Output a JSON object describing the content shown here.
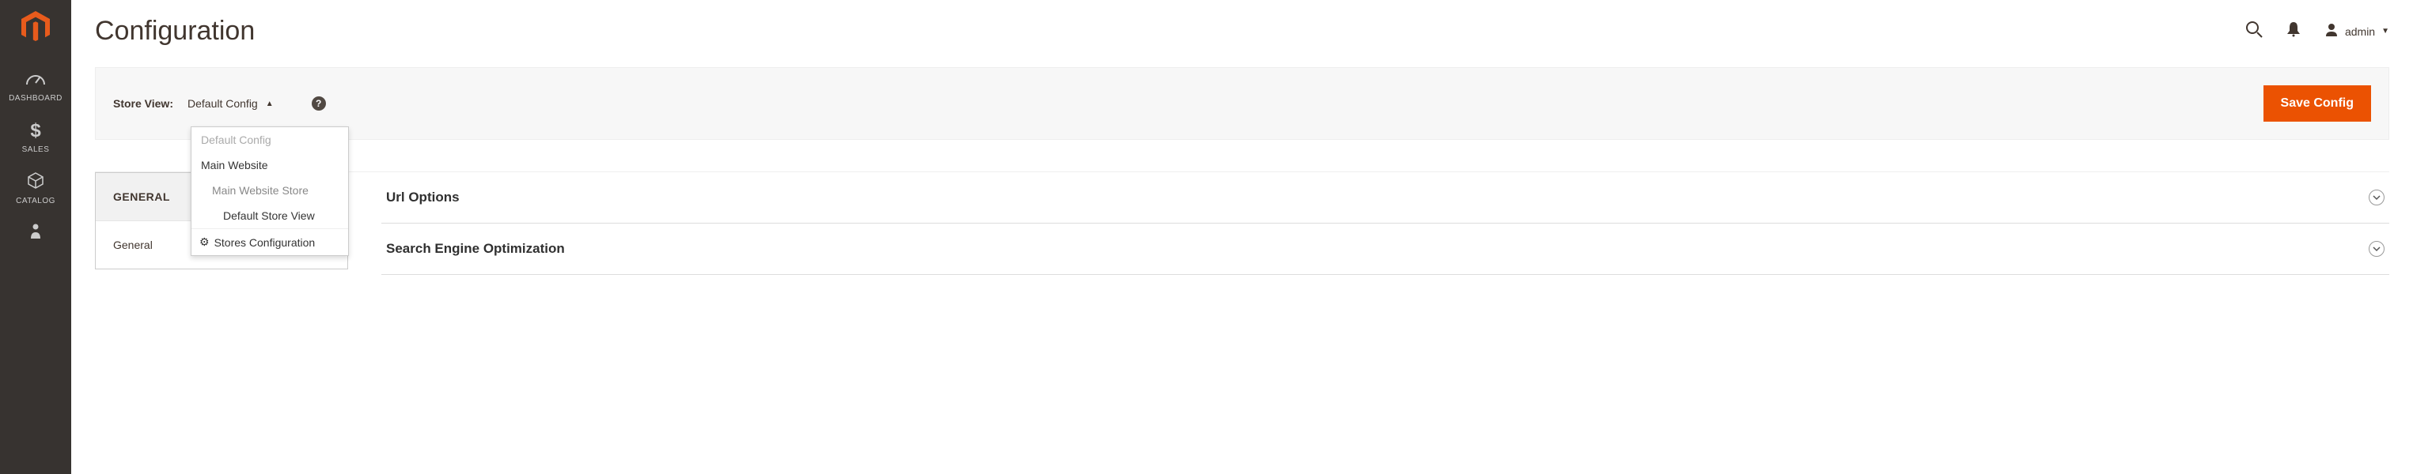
{
  "sidebar": {
    "items": [
      {
        "label": "DASHBOARD"
      },
      {
        "label": "SALES"
      },
      {
        "label": "CATALOG"
      },
      {
        "label": ""
      }
    ]
  },
  "header": {
    "title": "Configuration",
    "user": "admin"
  },
  "scope": {
    "label": "Store View:",
    "selected": "Default Config",
    "options": {
      "default": "Default Config",
      "website": "Main Website",
      "store": "Main Website Store",
      "storeview": "Default Store View"
    },
    "footer": "Stores Configuration"
  },
  "actions": {
    "save": "Save Config"
  },
  "tabs": {
    "group": "GENERAL",
    "items": [
      {
        "label": "General"
      }
    ]
  },
  "sections": [
    {
      "title": "Url Options"
    },
    {
      "title": "Search Engine Optimization"
    }
  ]
}
